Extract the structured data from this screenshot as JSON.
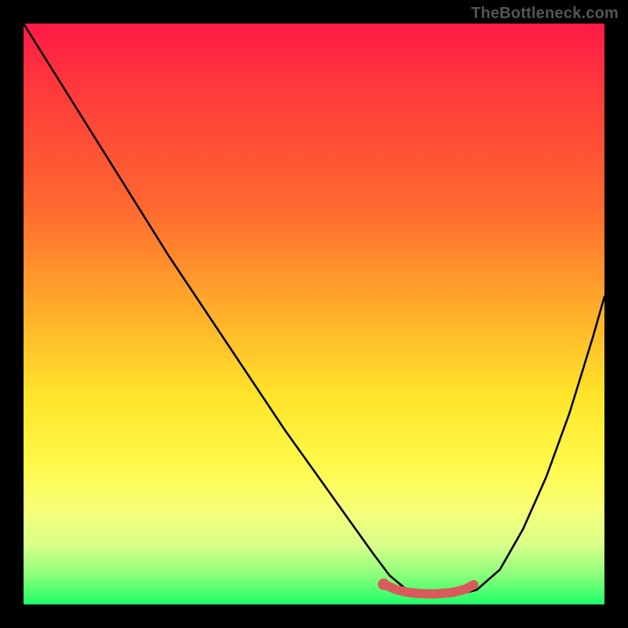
{
  "watermark": "TheBottleneck.com",
  "chart_data": {
    "type": "line",
    "title": "",
    "xlabel": "",
    "ylabel": "",
    "xlim": [
      0,
      100
    ],
    "ylim": [
      0,
      100
    ],
    "background_gradient": {
      "top_color": "#ff1a46",
      "bottom_color": "#1eff6a",
      "stops": [
        {
          "pos": 0.0,
          "color": "#ff1a46"
        },
        {
          "pos": 0.12,
          "color": "#ff3b3b"
        },
        {
          "pos": 0.32,
          "color": "#ff6a2f"
        },
        {
          "pos": 0.5,
          "color": "#ffb02a"
        },
        {
          "pos": 0.64,
          "color": "#ffe42a"
        },
        {
          "pos": 0.76,
          "color": "#fff94a"
        },
        {
          "pos": 0.84,
          "color": "#f6ff7a"
        },
        {
          "pos": 0.9,
          "color": "#d6ff8a"
        },
        {
          "pos": 0.95,
          "color": "#8aff7a"
        },
        {
          "pos": 1.0,
          "color": "#1eff6a"
        }
      ]
    },
    "series": [
      {
        "name": "bottleneck-curve",
        "color": "#000000",
        "x": [
          0,
          5,
          10,
          15,
          20,
          25,
          30,
          35,
          40,
          45,
          50,
          55,
          60,
          63,
          66,
          70,
          74,
          78,
          82,
          86,
          90,
          94,
          98,
          100
        ],
        "y": [
          100,
          92,
          84,
          76,
          68,
          60,
          52.5,
          45,
          37.5,
          30,
          23,
          16,
          9,
          5,
          2.5,
          1.5,
          1.5,
          2.5,
          6,
          13,
          22,
          33,
          46,
          53
        ]
      },
      {
        "name": "optimal-marker",
        "color": "#d95a5a",
        "type": "line-thick",
        "x": [
          62,
          64,
          66,
          68,
          70,
          72,
          74,
          76,
          77.5
        ],
        "y": [
          3.5,
          2.6,
          2.1,
          1.9,
          1.8,
          1.9,
          2.1,
          2.6,
          3.4
        ]
      }
    ]
  }
}
